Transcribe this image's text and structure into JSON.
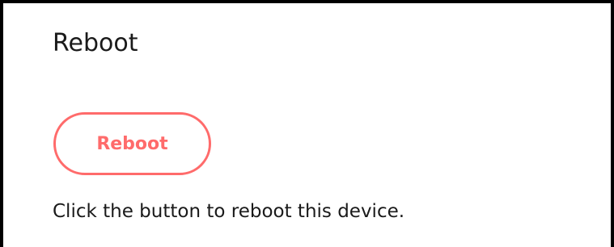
{
  "section": {
    "title": "Reboot",
    "button_label": "Reboot",
    "description": "Click the button to reboot this device."
  },
  "colors": {
    "accent": "#ff6b6b",
    "text": "#1a1a1a",
    "border": "#000000",
    "background": "#ffffff"
  }
}
